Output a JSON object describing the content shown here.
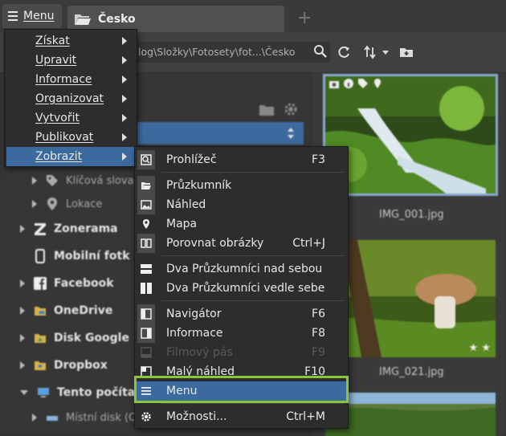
{
  "topbar": {
    "menu_label": "Menu",
    "tab_title": "Česko",
    "new_tab": "+"
  },
  "pathbar": {
    "path": "log\\Složky\\Fotosety\\fot...\\Česko"
  },
  "tree": {
    "sub_items": [
      {
        "label": "Klíčová slova"
      },
      {
        "label": "Lokace"
      }
    ],
    "items": [
      {
        "label": "Zonerama"
      },
      {
        "label": "Mobilní fotk"
      },
      {
        "label": "Facebook"
      },
      {
        "label": "OneDrive"
      },
      {
        "label": "Disk Google"
      },
      {
        "label": "Dropbox"
      },
      {
        "label": "Tento počíta"
      }
    ],
    "local_disk": "Místní disk (C"
  },
  "thumbnails": [
    {
      "name": "IMG_001.jpg"
    },
    {
      "name": "IMG_021.jpg"
    }
  ],
  "main_menu": {
    "items": [
      {
        "label": "Získat"
      },
      {
        "label": "Upravit"
      },
      {
        "label": "Informace"
      },
      {
        "label": "Organizovat"
      },
      {
        "label": "Vytvořit"
      },
      {
        "label": "Publikovat"
      },
      {
        "label": "Zobrazit"
      }
    ]
  },
  "submenu": {
    "items": [
      {
        "label": "Prohlížeč",
        "key": "F3",
        "icon": "viewer-icon"
      },
      {
        "label": "Průzkumník",
        "key": "",
        "icon": "folder-open-icon"
      },
      {
        "label": "Náhled",
        "key": "",
        "icon": "image-icon"
      },
      {
        "label": "Mapa",
        "key": "",
        "icon": "map-pin-icon"
      },
      {
        "label": "Porovnat obrázky",
        "key": "Ctrl+J",
        "icon": "compare-icon"
      },
      {
        "label": "Dva Průzkumníci nad sebou",
        "key": "",
        "icon": "split-horizontal-icon"
      },
      {
        "label": "Dva Průzkumníci vedle sebe",
        "key": "",
        "icon": "split-vertical-icon"
      },
      {
        "label": "Navigátor",
        "key": "F6",
        "icon": "navigator-icon"
      },
      {
        "label": "Informace",
        "key": "F8",
        "icon": "info-panel-icon"
      },
      {
        "label": "Filmový pás",
        "key": "F9",
        "icon": "filmstrip-icon"
      },
      {
        "label": "Malý náhled",
        "key": "F10",
        "icon": "small-preview-icon"
      },
      {
        "label": "Menu",
        "key": "",
        "icon": "menu-icon"
      },
      {
        "label": "Možnosti...",
        "key": "Ctrl+M",
        "icon": "gear-icon"
      }
    ]
  }
}
